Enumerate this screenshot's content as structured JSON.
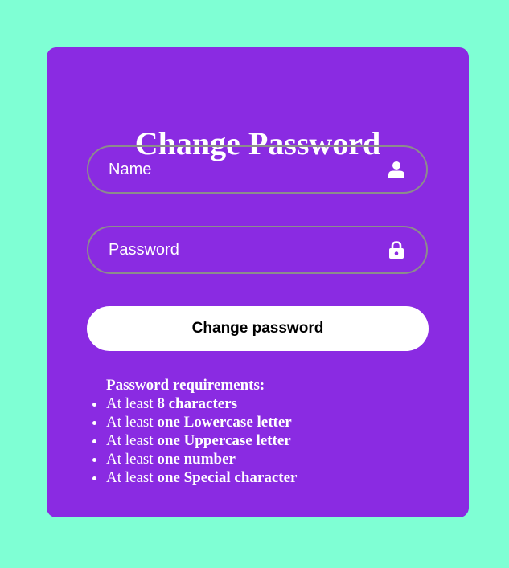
{
  "page": {
    "background_color": "#7fffd4",
    "card_color": "#8a2be2"
  },
  "form": {
    "title": "Change Password",
    "name_field": {
      "placeholder": "Name",
      "value": "",
      "icon": "user-icon"
    },
    "password_field": {
      "placeholder": "Password",
      "value": "",
      "icon": "lock-icon"
    },
    "submit_label": "Change password"
  },
  "requirements": {
    "heading": "Password requirements:",
    "items": [
      {
        "prefix": "At least",
        "emphasis": "8 characters"
      },
      {
        "prefix": "At least",
        "emphasis": "one Lowercase letter"
      },
      {
        "prefix": "At least",
        "emphasis": "one Uppercase letter"
      },
      {
        "prefix": "At least",
        "emphasis": "one number"
      },
      {
        "prefix": "At least",
        "emphasis": "one Special character"
      }
    ]
  }
}
